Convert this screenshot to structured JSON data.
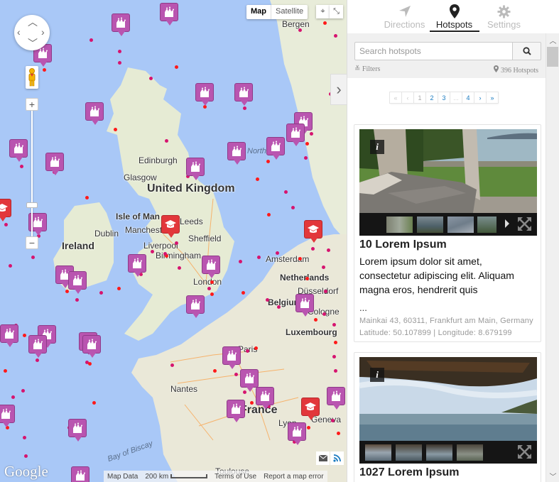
{
  "map": {
    "type_control": {
      "map_label": "Map",
      "satellite_label": "Satellite",
      "active": "Map"
    },
    "labels": {
      "cities": [
        "Bergen",
        "Edinburgh",
        "Glasgow",
        "Isle of Man",
        "Dublin",
        "Manchester",
        "Leeds",
        "Liverpool",
        "Sheffield",
        "Birmingham",
        "London",
        "Amsterdam",
        "Düsseldorf",
        "Cologne",
        "Paris",
        "Nantes",
        "Lyon",
        "Geneva",
        "Toulouse"
      ],
      "countries": [
        "United Kingdom",
        "Ireland",
        "Netherlands",
        "Belgium",
        "Luxembourg",
        "France"
      ],
      "seas": [
        "North Sea",
        "Bay of Biscay"
      ]
    },
    "marker_icon": "jester-hat-icon",
    "cluster_icon": "graduation-cap-icon",
    "attribution": {
      "logo": "Google",
      "map_data": "Map Data",
      "scale": "200 km",
      "terms": "Terms of Use",
      "report": "Report a map error"
    }
  },
  "panel": {
    "tabs": [
      {
        "label": "Directions",
        "icon": "navigation-arrow-icon",
        "active": false
      },
      {
        "label": "Hotspots",
        "icon": "map-pin-icon",
        "active": true
      },
      {
        "label": "Settings",
        "icon": "gear-icon",
        "active": false
      }
    ],
    "search": {
      "placeholder": "Search hotspots",
      "value": ""
    },
    "filters_label": "Filters",
    "hotspot_count": "396 Hotspots",
    "pagination": {
      "first": "«",
      "prev": "‹",
      "pages": [
        "1",
        "2",
        "3",
        "...",
        "4"
      ],
      "next": "›",
      "last": "»",
      "current": "1"
    },
    "results": [
      {
        "title": "10 Lorem Ipsum",
        "description": "Lorem ipsum dolor sit amet, consectetur adipiscing elit. Aliquam magna eros, hendrerit quis",
        "ellipsis": "...",
        "address": "Mainkai 43, 60311, Frankfurt am Main, Germany",
        "coords": "Latitude: 50.107899 | Longitude: 8.679199",
        "photo": "gazebo-by-the-sea",
        "thumbnails": 4
      },
      {
        "title": "1027 Lorem Ipsum",
        "photo": "sea-view-under-vines",
        "thumbnails": 4
      }
    ]
  }
}
